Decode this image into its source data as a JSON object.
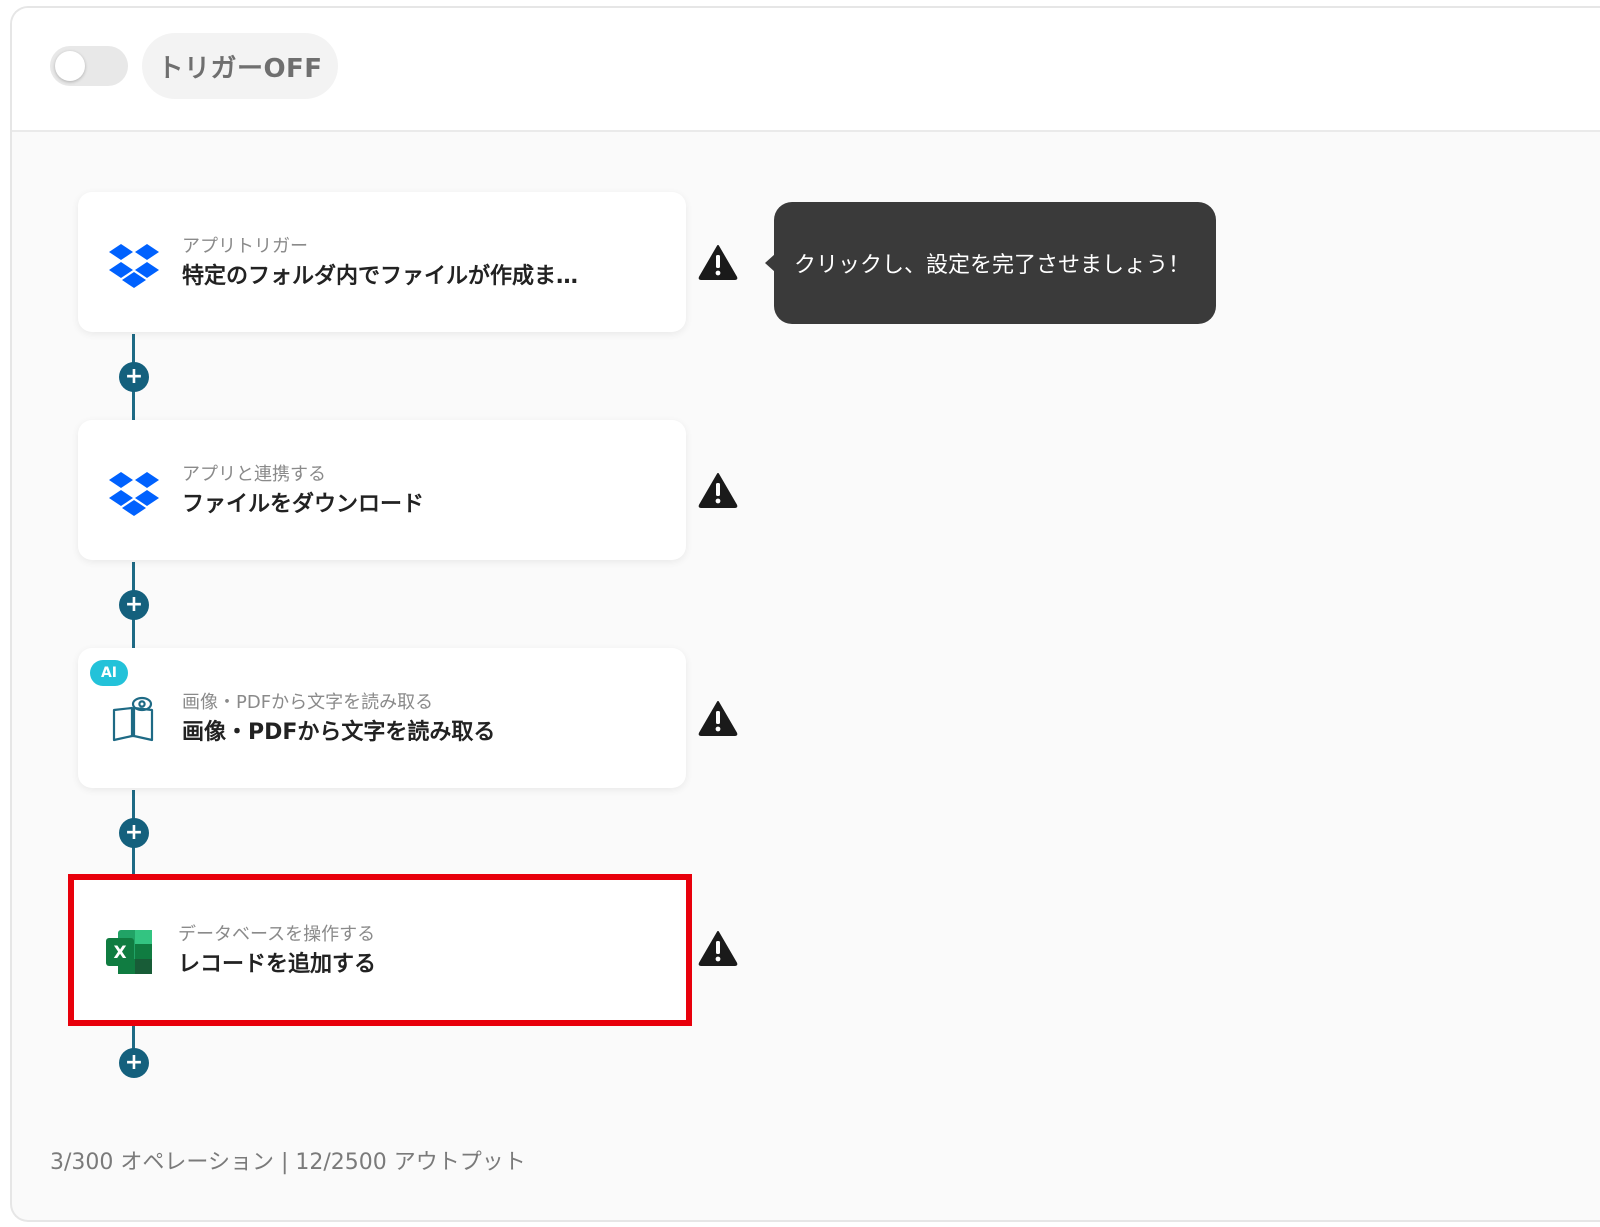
{
  "header": {
    "trigger_toggle_state": "off",
    "trigger_label": "トリガーOFF"
  },
  "tooltip": {
    "text": "クリックし、設定を完了させましょう！"
  },
  "steps": [
    {
      "category": "アプリトリガー",
      "title": "特定のフォルダ内でファイルが作成ま…",
      "icon": "dropbox-icon",
      "status_icon": "warning-icon"
    },
    {
      "category": "アプリと連携する",
      "title": "ファイルをダウンロード",
      "icon": "dropbox-icon",
      "status_icon": "warning-icon"
    },
    {
      "badge": "AI",
      "category": "画像・PDFから文字を読み取る",
      "title": "画像・PDFから文字を読み取る",
      "icon": "ocr-book-icon",
      "status_icon": "warning-icon"
    },
    {
      "category": "データベースを操作する",
      "title": "レコードを追加する",
      "icon": "excel-icon",
      "status_icon": "warning-icon",
      "highlighted": true
    }
  ],
  "add_step_symbol": "+",
  "footer": {
    "usage": "3/300 オペレーション | 12/2500 アウトプット"
  },
  "colors": {
    "connector": "#14607d",
    "highlight": "#e8000b",
    "tooltip_bg": "#3a3a3a",
    "ai_badge": "#23c2d9",
    "dropbox": "#0061fe",
    "excel": "#107c41"
  }
}
